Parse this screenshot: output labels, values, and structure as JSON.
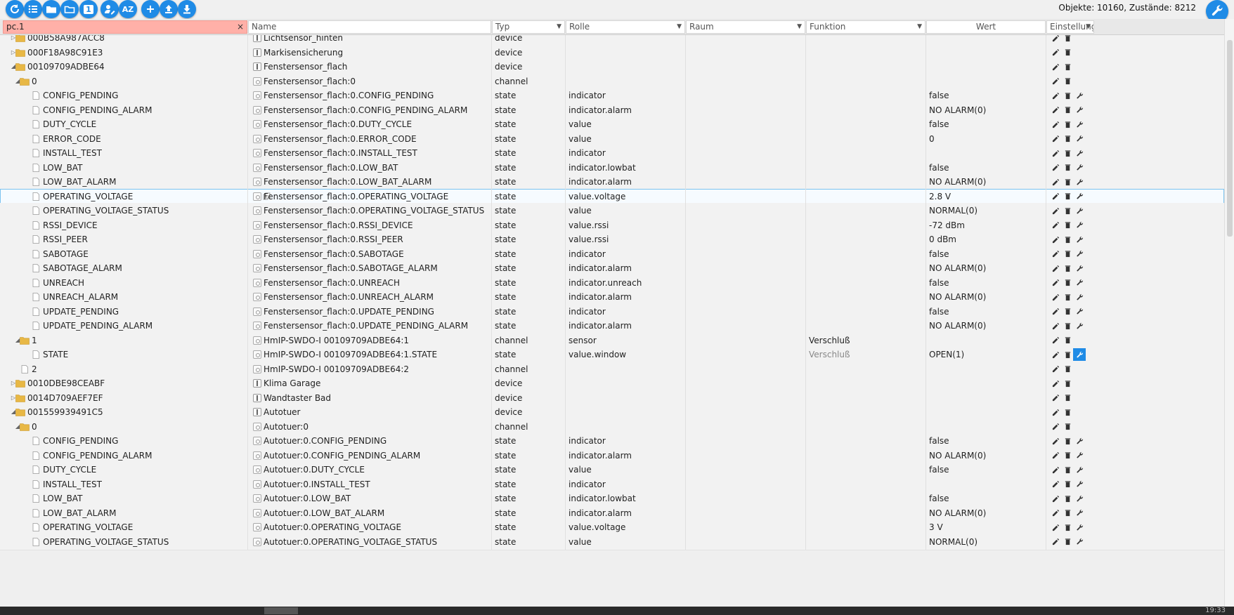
{
  "toolbar": {
    "buttons": [
      {
        "name": "refresh-icon"
      },
      {
        "name": "list-icon"
      },
      {
        "name": "folder-icon"
      },
      {
        "name": "folder-outline-icon"
      },
      {
        "name": "number-one-icon",
        "text": "1"
      },
      {
        "name": "user-edit-icon"
      },
      {
        "name": "sort-az-icon",
        "text": "AZ"
      },
      {
        "name": "add-icon"
      },
      {
        "name": "upload-icon"
      },
      {
        "name": "download-icon"
      }
    ],
    "counter": "Objekte: 10160, Zustände: 8212"
  },
  "header": {
    "filter_value": "pc.1",
    "filter_clear": "×",
    "col_name": "Name",
    "col_type": "Typ",
    "col_role": "Rolle",
    "col_room": "Raum",
    "col_function": "Funktion",
    "col_value": "Wert",
    "col_settings": "Einstellungen"
  },
  "colors": {
    "accent": "#1f8be6",
    "filter_bg": "#ffb0a8",
    "selected_outline": "#7cc3ef"
  },
  "rows": [
    {
      "id": "000B58A987ACC8",
      "level": 1,
      "node": "folder",
      "toggle": "closed",
      "name": "Lichtsensor_hinten",
      "name_icon": "device",
      "type": "device",
      "role": "",
      "function": "",
      "value": "",
      "actions": 2,
      "partial": true
    },
    {
      "id": "000F18A98C91E3",
      "level": 1,
      "node": "folder",
      "toggle": "closed",
      "name": "Markisensicherung",
      "name_icon": "device",
      "type": "device",
      "role": "",
      "function": "",
      "value": "",
      "actions": 2
    },
    {
      "id": "00109709ADBE64",
      "level": 1,
      "node": "folder",
      "toggle": "open",
      "name": "Fenstersensor_flach",
      "name_icon": "device",
      "type": "device",
      "role": "",
      "function": "",
      "value": "",
      "actions": 2
    },
    {
      "id": "0",
      "level": 2,
      "node": "folder",
      "toggle": "open",
      "name": "Fenstersensor_flach:0",
      "name_icon": "channel",
      "type": "channel",
      "role": "",
      "function": "",
      "value": "",
      "actions": 2
    },
    {
      "id": "CONFIG_PENDING",
      "level": 3,
      "node": "file",
      "name": "Fenstersensor_flach:0.CONFIG_PENDING",
      "name_icon": "state",
      "type": "state",
      "role": "indicator",
      "function": "",
      "value": "false",
      "actions": 3
    },
    {
      "id": "CONFIG_PENDING_ALARM",
      "level": 3,
      "node": "file",
      "name": "Fenstersensor_flach:0.CONFIG_PENDING_ALARM",
      "name_icon": "state",
      "type": "state",
      "role": "indicator.alarm",
      "function": "",
      "value": "NO ALARM(0)",
      "actions": 3
    },
    {
      "id": "DUTY_CYCLE",
      "level": 3,
      "node": "file",
      "name": "Fenstersensor_flach:0.DUTY_CYCLE",
      "name_icon": "state",
      "type": "state",
      "role": "value",
      "function": "",
      "value": "false",
      "actions": 3
    },
    {
      "id": "ERROR_CODE",
      "level": 3,
      "node": "file",
      "name": "Fenstersensor_flach:0.ERROR_CODE",
      "name_icon": "state",
      "type": "state",
      "role": "value",
      "function": "",
      "value": "0",
      "actions": 3
    },
    {
      "id": "INSTALL_TEST",
      "level": 3,
      "node": "file",
      "name": "Fenstersensor_flach:0.INSTALL_TEST",
      "name_icon": "state",
      "type": "state",
      "role": "indicator",
      "function": "",
      "value": "",
      "actions": 3
    },
    {
      "id": "LOW_BAT",
      "level": 3,
      "node": "file",
      "name": "Fenstersensor_flach:0.LOW_BAT",
      "name_icon": "state",
      "type": "state",
      "role": "indicator.lowbat",
      "function": "",
      "value": "false",
      "actions": 3
    },
    {
      "id": "LOW_BAT_ALARM",
      "level": 3,
      "node": "file",
      "name": "Fenstersensor_flach:0.LOW_BAT_ALARM",
      "name_icon": "state",
      "type": "state",
      "role": "indicator.alarm",
      "function": "",
      "value": "NO ALARM(0)",
      "actions": 3
    },
    {
      "id": "OPERATING_VOLTAGE",
      "level": 3,
      "node": "file",
      "name": "Fenstersensor_flach:0.OPERATING_VOLTAGE",
      "name_icon": "state",
      "type": "state",
      "role": "value.voltage",
      "function": "",
      "value": "2.8 V",
      "actions": 3,
      "selected": true
    },
    {
      "id": "OPERATING_VOLTAGE_STATUS",
      "level": 3,
      "node": "file",
      "name": "Fenstersensor_flach:0.OPERATING_VOLTAGE_STATUS",
      "name_icon": "state",
      "type": "state",
      "role": "value",
      "function": "",
      "value": "NORMAL(0)",
      "actions": 3
    },
    {
      "id": "RSSI_DEVICE",
      "level": 3,
      "node": "file",
      "name": "Fenstersensor_flach:0.RSSI_DEVICE",
      "name_icon": "state",
      "type": "state",
      "role": "value.rssi",
      "function": "",
      "value": "-72 dBm",
      "actions": 3
    },
    {
      "id": "RSSI_PEER",
      "level": 3,
      "node": "file",
      "name": "Fenstersensor_flach:0.RSSI_PEER",
      "name_icon": "state",
      "type": "state",
      "role": "value.rssi",
      "function": "",
      "value": "0 dBm",
      "actions": 3
    },
    {
      "id": "SABOTAGE",
      "level": 3,
      "node": "file",
      "name": "Fenstersensor_flach:0.SABOTAGE",
      "name_icon": "state",
      "type": "state",
      "role": "indicator",
      "function": "",
      "value": "false",
      "actions": 3
    },
    {
      "id": "SABOTAGE_ALARM",
      "level": 3,
      "node": "file",
      "name": "Fenstersensor_flach:0.SABOTAGE_ALARM",
      "name_icon": "state",
      "type": "state",
      "role": "indicator.alarm",
      "function": "",
      "value": "NO ALARM(0)",
      "actions": 3
    },
    {
      "id": "UNREACH",
      "level": 3,
      "node": "file",
      "name": "Fenstersensor_flach:0.UNREACH",
      "name_icon": "state",
      "type": "state",
      "role": "indicator.unreach",
      "function": "",
      "value": "false",
      "actions": 3
    },
    {
      "id": "UNREACH_ALARM",
      "level": 3,
      "node": "file",
      "name": "Fenstersensor_flach:0.UNREACH_ALARM",
      "name_icon": "state",
      "type": "state",
      "role": "indicator.alarm",
      "function": "",
      "value": "NO ALARM(0)",
      "actions": 3
    },
    {
      "id": "UPDATE_PENDING",
      "level": 3,
      "node": "file",
      "name": "Fenstersensor_flach:0.UPDATE_PENDING",
      "name_icon": "state",
      "type": "state",
      "role": "indicator",
      "function": "",
      "value": "false",
      "actions": 3
    },
    {
      "id": "UPDATE_PENDING_ALARM",
      "level": 3,
      "node": "file",
      "name": "Fenstersensor_flach:0.UPDATE_PENDING_ALARM",
      "name_icon": "state",
      "type": "state",
      "role": "indicator.alarm",
      "function": "",
      "value": "NO ALARM(0)",
      "actions": 3
    },
    {
      "id": "1",
      "level": 2,
      "node": "folder",
      "toggle": "open",
      "name": "HmIP-SWDO-I 00109709ADBE64:1",
      "name_icon": "channel",
      "type": "channel",
      "role": "sensor",
      "function": "Verschluß",
      "value": "",
      "actions": 2
    },
    {
      "id": "STATE",
      "level": 3,
      "node": "file",
      "name": "HmIP-SWDO-I 00109709ADBE64:1.STATE",
      "name_icon": "state",
      "type": "state",
      "role": "value.window",
      "function": "Verschluß",
      "function_muted": true,
      "value": "OPEN(1)",
      "actions": 3,
      "wrench_active": true
    },
    {
      "id": "2",
      "level": 2,
      "node": "file",
      "name": "HmIP-SWDO-I 00109709ADBE64:2",
      "name_icon": "channel",
      "type": "channel",
      "role": "",
      "function": "",
      "value": "",
      "actions": 2
    },
    {
      "id": "0010DBE98CEABF",
      "level": 1,
      "node": "folder",
      "toggle": "closed",
      "name": "Klima Garage",
      "name_icon": "device",
      "type": "device",
      "role": "",
      "function": "",
      "value": "",
      "actions": 2
    },
    {
      "id": "0014D709AEF7EF",
      "level": 1,
      "node": "folder",
      "toggle": "closed",
      "name": "Wandtaster Bad",
      "name_icon": "device",
      "type": "device",
      "role": "",
      "function": "",
      "value": "",
      "actions": 2
    },
    {
      "id": "001559939491C5",
      "level": 1,
      "node": "folder",
      "toggle": "open",
      "name": "Autotuer",
      "name_icon": "device",
      "type": "device",
      "role": "",
      "function": "",
      "value": "",
      "actions": 2
    },
    {
      "id": "0",
      "level": 2,
      "node": "folder",
      "toggle": "open",
      "name": "Autotuer:0",
      "name_icon": "channel",
      "type": "channel",
      "role": "",
      "function": "",
      "value": "",
      "actions": 2
    },
    {
      "id": "CONFIG_PENDING",
      "level": 3,
      "node": "file",
      "name": "Autotuer:0.CONFIG_PENDING",
      "name_icon": "state",
      "type": "state",
      "role": "indicator",
      "function": "",
      "value": "false",
      "actions": 3
    },
    {
      "id": "CONFIG_PENDING_ALARM",
      "level": 3,
      "node": "file",
      "name": "Autotuer:0.CONFIG_PENDING_ALARM",
      "name_icon": "state",
      "type": "state",
      "role": "indicator.alarm",
      "function": "",
      "value": "NO ALARM(0)",
      "actions": 3
    },
    {
      "id": "DUTY_CYCLE",
      "level": 3,
      "node": "file",
      "name": "Autotuer:0.DUTY_CYCLE",
      "name_icon": "state",
      "type": "state",
      "role": "value",
      "function": "",
      "value": "false",
      "actions": 3
    },
    {
      "id": "INSTALL_TEST",
      "level": 3,
      "node": "file",
      "name": "Autotuer:0.INSTALL_TEST",
      "name_icon": "state",
      "type": "state",
      "role": "indicator",
      "function": "",
      "value": "",
      "actions": 3
    },
    {
      "id": "LOW_BAT",
      "level": 3,
      "node": "file",
      "name": "Autotuer:0.LOW_BAT",
      "name_icon": "state",
      "type": "state",
      "role": "indicator.lowbat",
      "function": "",
      "value": "false",
      "actions": 3
    },
    {
      "id": "LOW_BAT_ALARM",
      "level": 3,
      "node": "file",
      "name": "Autotuer:0.LOW_BAT_ALARM",
      "name_icon": "state",
      "type": "state",
      "role": "indicator.alarm",
      "function": "",
      "value": "NO ALARM(0)",
      "actions": 3
    },
    {
      "id": "OPERATING_VOLTAGE",
      "level": 3,
      "node": "file",
      "name": "Autotuer:0.OPERATING_VOLTAGE",
      "name_icon": "state",
      "type": "state",
      "role": "value.voltage",
      "function": "",
      "value": "3 V",
      "actions": 3
    },
    {
      "id": "OPERATING_VOLTAGE_STATUS",
      "level": 3,
      "node": "file",
      "name": "Autotuer:0.OPERATING_VOLTAGE_STATUS",
      "name_icon": "state",
      "type": "state",
      "role": "value",
      "function": "",
      "value": "NORMAL(0)",
      "actions": 3
    }
  ],
  "statusbar": {
    "clock": "19:33"
  }
}
